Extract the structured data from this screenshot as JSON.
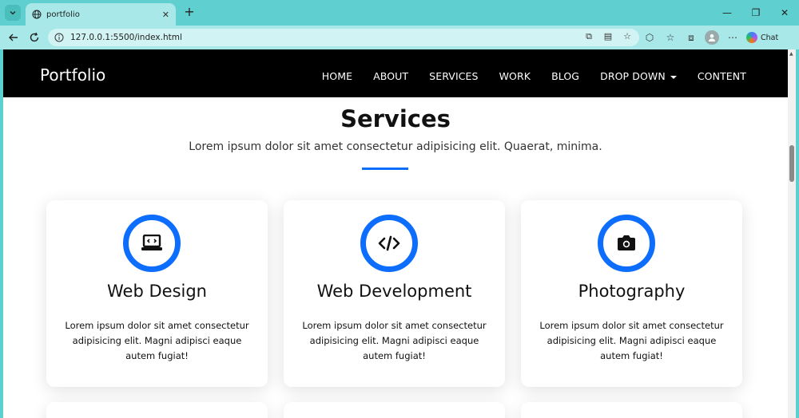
{
  "browser": {
    "tab_title": "portfolio",
    "url": "127.0.0.1:5500/index.html",
    "chat_label": "Chat"
  },
  "nav": {
    "brand": "Portfolio",
    "items": [
      "HOME",
      "ABOUT",
      "SERVICES",
      "WORK",
      "BLOG",
      "DROP DOWN",
      "CONTENT"
    ]
  },
  "services": {
    "title": "Services",
    "subtitle": "Lorem ipsum dolor sit amet consectetur adipisicing elit. Quaerat, minima.",
    "accent_color": "#0d6efd",
    "cards": [
      {
        "title": "Web Design",
        "icon": "laptop-code-icon",
        "text": "Lorem ipsum dolor sit amet consectetur adipisicing elit. Magni adipisci eaque autem fugiat!"
      },
      {
        "title": "Web Development",
        "icon": "code-icon",
        "text": "Lorem ipsum dolor sit amet consectetur adipisicing elit. Magni adipisci eaque autem fugiat!"
      },
      {
        "title": "Photography",
        "icon": "camera-icon",
        "text": "Lorem ipsum dolor sit amet consectetur adipisicing elit. Magni adipisci eaque autem fugiat!"
      }
    ]
  }
}
